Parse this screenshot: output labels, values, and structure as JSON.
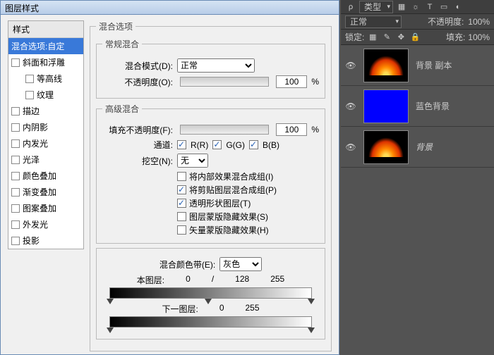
{
  "dialog": {
    "title": "图层样式",
    "sidebar": {
      "header": "样式",
      "selected": "混合选项:自定",
      "items": [
        {
          "label": "斜面和浮雕"
        },
        {
          "label": "等高线",
          "indent": true
        },
        {
          "label": "纹理",
          "indent": true
        },
        {
          "label": "描边"
        },
        {
          "label": "内阴影"
        },
        {
          "label": "内发光"
        },
        {
          "label": "光泽"
        },
        {
          "label": "颜色叠加"
        },
        {
          "label": "渐变叠加"
        },
        {
          "label": "图案叠加"
        },
        {
          "label": "外发光"
        },
        {
          "label": "投影"
        }
      ]
    },
    "groups": {
      "blend_options": "混合选项",
      "general": {
        "legend": "常规混合",
        "mode_label": "混合模式(D):",
        "mode_value": "正常",
        "opacity_label": "不透明度(O):",
        "opacity_value": "100",
        "pct": "%"
      },
      "adv": {
        "legend": "高级混合",
        "fill_label": "填充不透明度(F):",
        "fill_value": "100",
        "pct": "%",
        "channel_label": "通道:",
        "r": "R(R)",
        "g": "G(G)",
        "b": "B(B)",
        "knockout_label": "挖空(N):",
        "knockout_value": "无",
        "opt1": "将内部效果混合成组(I)",
        "opt2": "将剪贴图层混合成组(P)",
        "opt3": "透明形状图层(T)",
        "opt4": "图层蒙版隐藏效果(S)",
        "opt5": "矢量蒙版隐藏效果(H)"
      },
      "blendif": {
        "label": "混合颜色带(E):",
        "select": "灰色",
        "this_label": "本图层:",
        "this_lo": "0",
        "this_div": "/",
        "this_mid": "128",
        "this_hi": "255",
        "under_label": "下一图层:",
        "under_lo": "0",
        "under_hi": "255"
      }
    }
  },
  "layers_panel": {
    "filter_label": "类型",
    "filter_icons": [
      "▦",
      "☼",
      "T",
      "▭",
      "◐"
    ],
    "mode": "正常",
    "opacity_label": "不透明度:",
    "opacity_value": "100%",
    "lock_label": "锁定:",
    "fill_label": "填充:",
    "fill_value": "100%",
    "layers": [
      {
        "name": "背景 副本",
        "thumb": "fire",
        "visible": true
      },
      {
        "name": "蓝色背景",
        "thumb": "blue",
        "visible": true
      },
      {
        "name": "背景",
        "thumb": "fire",
        "visible": true,
        "italic": true
      }
    ]
  }
}
